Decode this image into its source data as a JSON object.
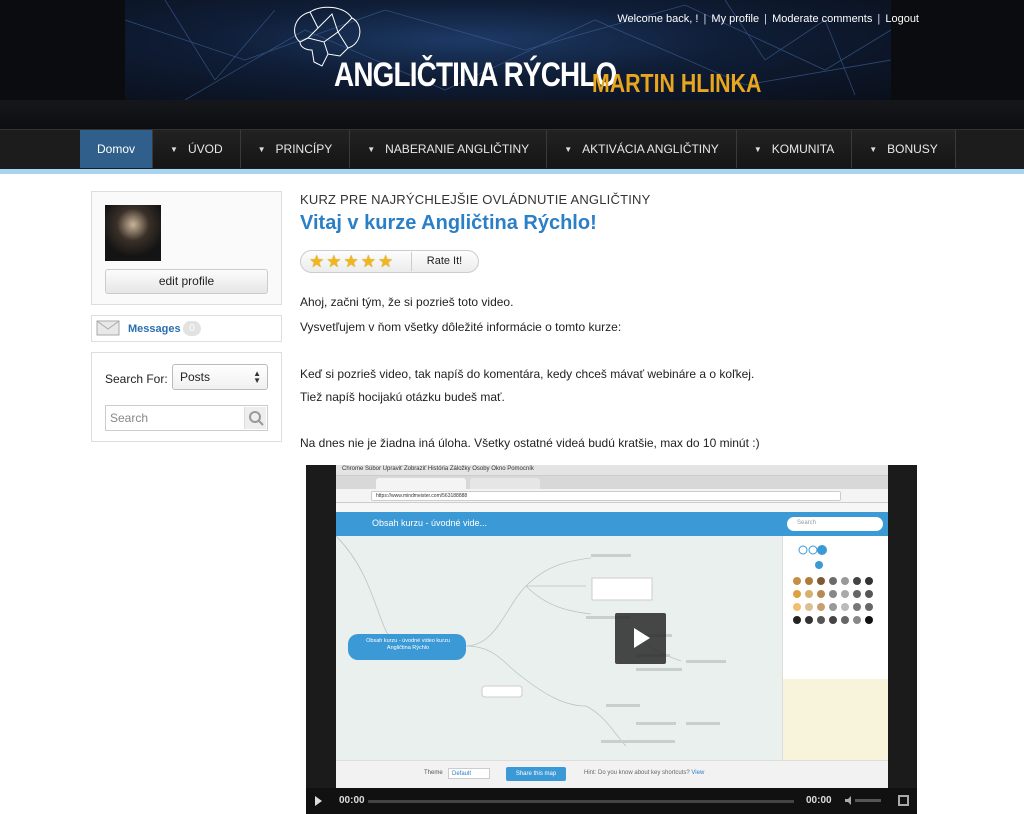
{
  "header": {
    "brand_title": "ANGLIČTINA RÝCHLO",
    "brand_sub": "MARTIN HLINKA",
    "welcome_text": "Welcome back, !",
    "links": [
      "My profile",
      "Moderate comments",
      "Logout"
    ]
  },
  "nav": {
    "items": [
      {
        "label": "Domov",
        "active": true
      },
      {
        "label": "ÚVOD"
      },
      {
        "label": "PRINCÍPY"
      },
      {
        "label": "NABERANIE ANGLIČTINY"
      },
      {
        "label": "AKTIVÁCIA ANGLIČTINY"
      },
      {
        "label": "KOMUNITA"
      },
      {
        "label": "BONUSY"
      }
    ]
  },
  "sidebar": {
    "edit_profile": "edit profile",
    "messages_label": "Messages",
    "messages_count": "0",
    "search_for_label": "Search For:",
    "search_select_value": "Posts",
    "search_placeholder": "Search"
  },
  "main": {
    "subtitle": "KURZ PRE NAJRÝCHLEJŠIE OVLÁDNUTIE ANGLIČTINY",
    "title": "Vitaj v kurze Angličtina Rýchlo!",
    "stars": "★★★★★",
    "rate_label": "Rate It!",
    "paragraphs": [
      "Ahoj, začni tým, že si pozrieš toto video.",
      "Vysvetľujem v ňom všetky dôležité informácie o tomto kurze:",
      "Keď si pozrieš video, tak napíš do komentára, kedy chceš mávať webináre a o koľkej.",
      "Tiež napíš hocijakú otázku budeš mať.",
      "Na dnes nie je žiadna iná úloha. Všetky ostatné videá budú kratšie, max do 10 minút :)"
    ]
  },
  "video": {
    "mac_menu": "Chrome  Súbor  Upraviť  Zobraziť  História  Záložky  Osoby  Okno  Pomocník",
    "url": "https://www.mindmeister.com/563188888",
    "map_title": "Obsah kurzu - úvodné vide...",
    "map_search": "Search",
    "central_node": "Obsah kurzu - úvodné video kurzu Angličtina Rýchlo",
    "theme_label": "Theme",
    "theme_value": "Default",
    "share_label": "Share this map",
    "hint_text": "Hint: Do you know about key shortcuts?",
    "hint_link": "View",
    "time_current": "00:00",
    "time_total": "00:00",
    "brand_color": "#3b9ad6"
  }
}
